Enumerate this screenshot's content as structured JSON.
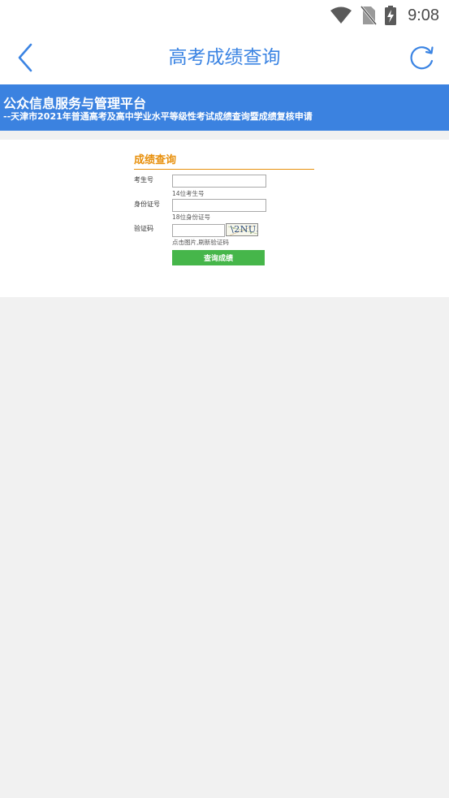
{
  "status_bar": {
    "time": "9:08",
    "icons": [
      "wifi-icon",
      "no-sim-icon",
      "battery-charging-icon"
    ]
  },
  "title_bar": {
    "title": "高考成绩查询",
    "back_icon": "chevron-left-icon",
    "refresh_icon": "refresh-icon",
    "accent_color": "#3b84e3"
  },
  "banner": {
    "title": "公众信息服务与管理平台",
    "subtitle": "--天津市2021年普通高考及高中学业水平等级性考试成绩查询暨成绩复核申请",
    "background_color": "#3b82e0"
  },
  "form": {
    "header": "成绩查询",
    "header_color": "#e8900c",
    "fields": {
      "exam_number": {
        "label": "考生号",
        "value": "",
        "hint": "14位考生号"
      },
      "id_number": {
        "label": "身份证号",
        "value": "",
        "hint": "18位身份证号"
      },
      "captcha": {
        "label": "验证码",
        "value": "",
        "hint": "点击图片,刷新验证码",
        "image_text": "\\2NU5"
      }
    },
    "submit_label": "查询成绩",
    "submit_color": "#46b64a"
  }
}
